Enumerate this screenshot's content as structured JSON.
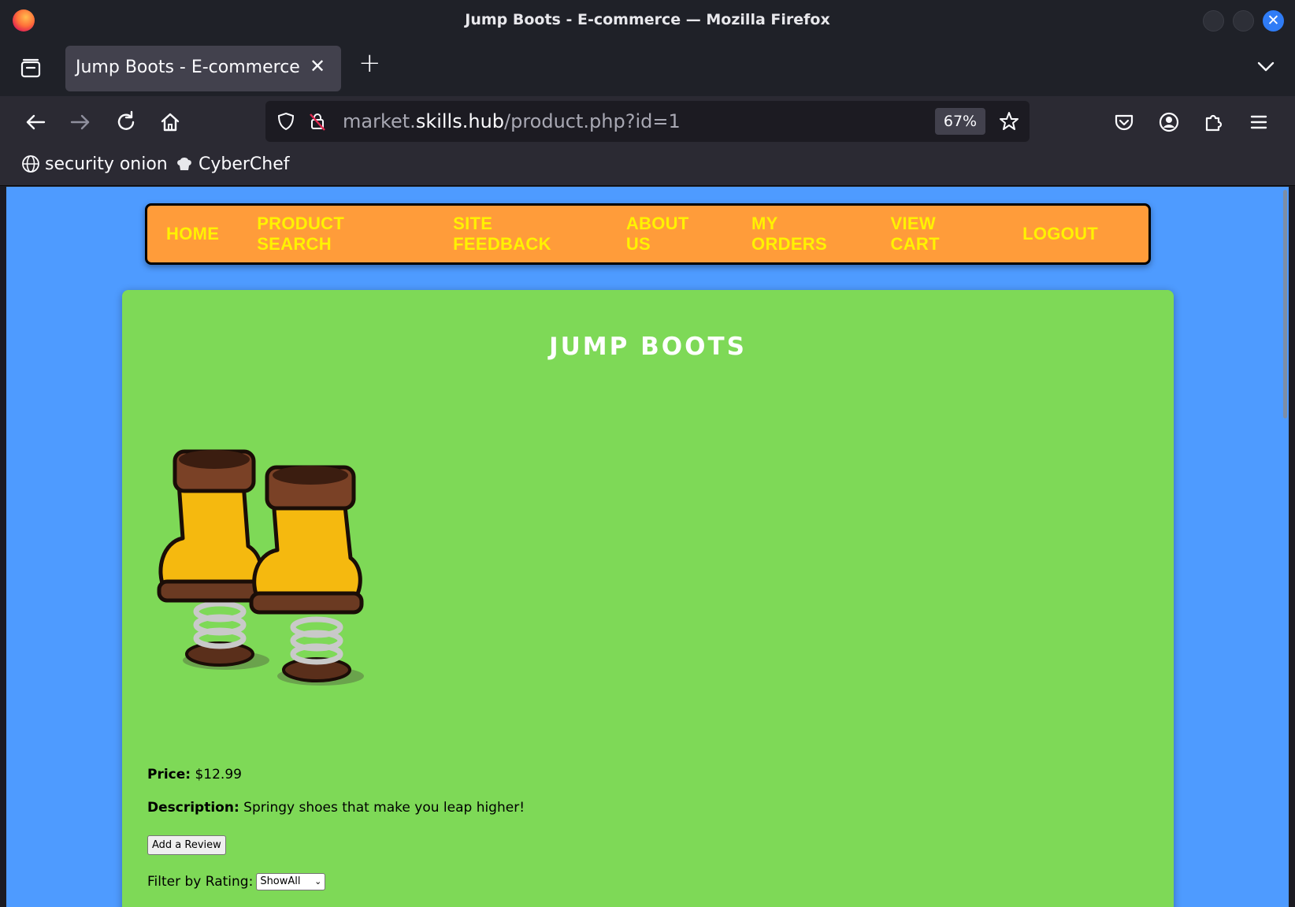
{
  "window": {
    "title": "Jump Boots - E-commerce — Mozilla Firefox",
    "close_glyph": "✕"
  },
  "tabs": [
    {
      "title": "Jump Boots - E-commerce",
      "close_glyph": "✕"
    }
  ],
  "new_tab_glyph": "+",
  "urlbar": {
    "prefix": "market.",
    "host": "skills.hub",
    "path": "/product.php?id=1",
    "zoom": "67%"
  },
  "bookmarks": [
    {
      "label": "security onion",
      "icon": "globe-icon"
    },
    {
      "label": "CyberChef",
      "icon": "chef-hat-icon"
    }
  ],
  "site_nav": {
    "items": [
      "HOME",
      "PRODUCT SEARCH",
      "SITE FEEDBACK",
      "ABOUT US",
      "MY ORDERS",
      "VIEW CART",
      "LOGOUT"
    ]
  },
  "product": {
    "title": "JUMP BOOTS",
    "price_label": "Price:",
    "price_value": "$12.99",
    "description_label": "Description:",
    "description_value": "Springy shoes that make you leap higher!",
    "review_button": "Add a Review",
    "filter_label": "Filter by Rating:",
    "filter_selected": "ShowAll"
  },
  "colors": {
    "page_bg": "#4e9bff",
    "nav_bg": "#ff9c3a",
    "nav_text": "#fff200",
    "card_bg": "#7ed957"
  }
}
